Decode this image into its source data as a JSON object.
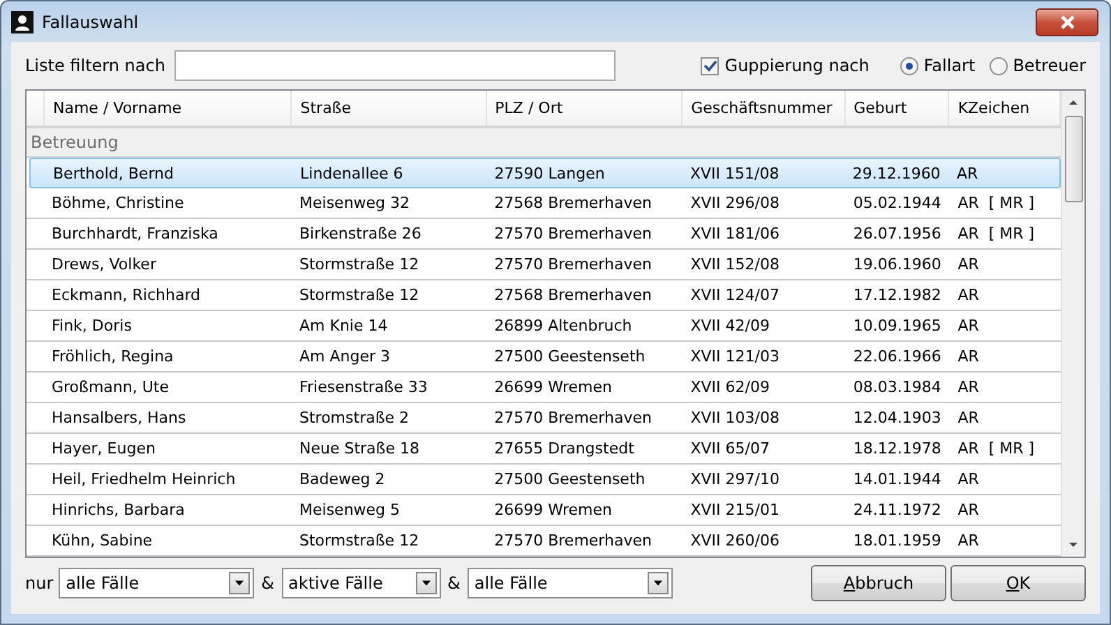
{
  "window": {
    "title": "Fallauswahl"
  },
  "filter": {
    "label": "Liste filtern nach"
  },
  "grouping": {
    "label": "Guppierung nach",
    "checked": true,
    "options": [
      {
        "label": "Fallart",
        "selected": true
      },
      {
        "label": "Betreuer",
        "selected": false
      }
    ]
  },
  "table": {
    "columns": [
      "Name / Vorname",
      "Straße",
      "PLZ / Ort",
      "Geschäftsnummer",
      "Geburt",
      "KZeichen"
    ],
    "group": "Betreuung",
    "rows": [
      {
        "cells": [
          "Berthold, Bernd",
          "Lindenallee 6",
          "27590 Langen",
          "XVII 151/08",
          "29.12.1960",
          "AR"
        ],
        "selected": true
      },
      {
        "cells": [
          "Böhme, Christine",
          "Meisenweg 32",
          "27568 Bremerhaven",
          "XVII 296/08",
          "05.02.1944",
          "AR  [ MR ]"
        ],
        "selected": false
      },
      {
        "cells": [
          "Burchhardt, Franziska",
          "Birkenstraße 26",
          "27570 Bremerhaven",
          "XVII 181/06",
          "26.07.1956",
          "AR  [ MR ]"
        ],
        "selected": false
      },
      {
        "cells": [
          "Drews, Volker",
          "Stormstraße 12",
          "27570 Bremerhaven",
          "XVII 152/08",
          "19.06.1960",
          "AR"
        ],
        "selected": false
      },
      {
        "cells": [
          "Eckmann, Richhard",
          "Stormstraße 12",
          "27568 Bremerhaven",
          "XVII 124/07",
          "17.12.1982",
          "AR"
        ],
        "selected": false
      },
      {
        "cells": [
          "Fink, Doris",
          "Am Knie 14",
          "26899 Altenbruch",
          "XVII 42/09",
          "10.09.1965",
          "AR"
        ],
        "selected": false
      },
      {
        "cells": [
          "Fröhlich, Regina",
          "Am Anger 3",
          "27500 Geestenseth",
          "XVII 121/03",
          "22.06.1966",
          "AR"
        ],
        "selected": false
      },
      {
        "cells": [
          "Großmann, Ute",
          "Friesenstraße 33",
          "26699 Wremen",
          "XVII 62/09",
          "08.03.1984",
          "AR"
        ],
        "selected": false
      },
      {
        "cells": [
          "Hansalbers, Hans",
          "Stromstraße 2",
          "27570 Bremerhaven",
          "XVII 103/08",
          "12.04.1903",
          "AR"
        ],
        "selected": false
      },
      {
        "cells": [
          "Hayer, Eugen",
          "Neue Straße 18",
          "27655 Drangstedt",
          "XVII 65/07",
          "18.12.1978",
          "AR  [ MR ]"
        ],
        "selected": false
      },
      {
        "cells": [
          "Heil, Friedhelm Heinrich",
          "Badeweg 2",
          "27500 Geestenseth",
          "XVII 297/10",
          "14.01.1944",
          "AR"
        ],
        "selected": false
      },
      {
        "cells": [
          "Hinrichs, Barbara",
          "Meisenweg 5",
          "26699 Wremen",
          "XVII 215/01",
          "24.11.1972",
          "AR"
        ],
        "selected": false
      },
      {
        "cells": [
          "Kühn, Sabine",
          "Stormstraße 12",
          "27570 Bremerhaven",
          "XVII 260/06",
          "18.01.1959",
          "AR"
        ],
        "selected": false
      }
    ]
  },
  "footer": {
    "label": "nur",
    "combos": [
      {
        "value": "alle Fälle"
      },
      {
        "joiner": "&",
        "value": "aktive Fälle"
      },
      {
        "joiner": "&",
        "value": "alle Fälle"
      }
    ],
    "buttons": [
      "Abbruch",
      "OK"
    ]
  }
}
